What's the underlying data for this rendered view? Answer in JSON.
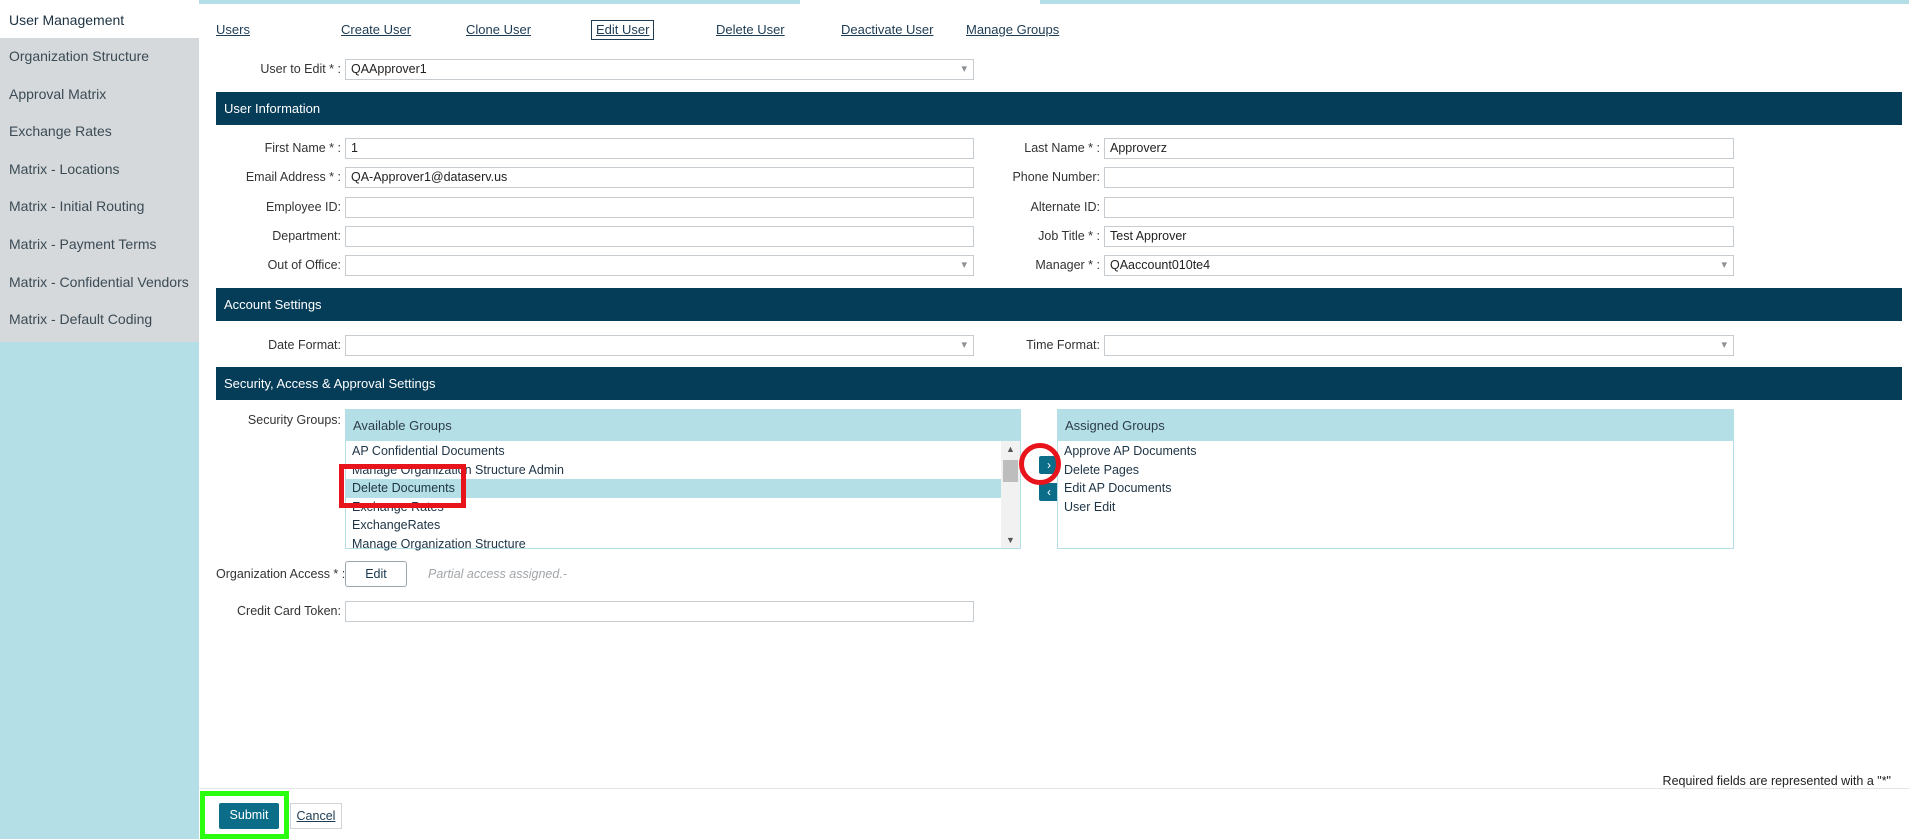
{
  "sidebar": {
    "items": [
      {
        "label": "User Management"
      },
      {
        "label": "Organization Structure"
      },
      {
        "label": "Approval Matrix"
      },
      {
        "label": "Exchange Rates"
      },
      {
        "label": "Matrix - Locations"
      },
      {
        "label": "Matrix - Initial Routing"
      },
      {
        "label": "Matrix - Payment Terms"
      },
      {
        "label": "Matrix - Confidential Vendors"
      },
      {
        "label": "Matrix - Default Coding"
      }
    ]
  },
  "tabs": {
    "users": "Users",
    "create": "Create User",
    "clone": "Clone User",
    "edit": "Edit User",
    "delete": "Delete User",
    "deactivate": "Deactivate User",
    "groups": "Manage Groups"
  },
  "user_to_edit": {
    "label": "User to Edit * :",
    "value": "QAApprover1"
  },
  "sections": {
    "user_info": "User Information",
    "account": "Account Settings",
    "security": "Security, Access & Approval Settings"
  },
  "user_info": {
    "first_name": {
      "label": "First Name * :",
      "value": "1"
    },
    "email": {
      "label": "Email Address * :",
      "value": "QA-Approver1@dataserv.us"
    },
    "employee_id": {
      "label": "Employee ID:",
      "value": ""
    },
    "department": {
      "label": "Department:",
      "value": ""
    },
    "out_of_office": {
      "label": "Out of Office:",
      "value": ""
    },
    "last_name": {
      "label": "Last Name * :",
      "value": "Approverz"
    },
    "phone": {
      "label": "Phone Number:",
      "value": ""
    },
    "alternate_id": {
      "label": "Alternate ID:",
      "value": ""
    },
    "job_title": {
      "label": "Job Title * :",
      "value": "Test Approver"
    },
    "manager": {
      "label": "Manager * :",
      "value": "QAaccount010te4"
    }
  },
  "account": {
    "date_format": {
      "label": "Date Format:",
      "value": ""
    },
    "time_format": {
      "label": "Time Format:",
      "value": ""
    }
  },
  "security": {
    "label": "Security Groups:",
    "available_title": "Available Groups",
    "available": [
      "AP Confidential Documents",
      "Manage Organization Structure Admin",
      "Delete Documents",
      "Exchange Rates",
      "ExchangeRates",
      "Manage Organization Structure"
    ],
    "assigned_title": "Assigned Groups",
    "assigned": [
      "Approve AP Documents",
      "Delete Pages",
      "Edit AP Documents",
      "User Edit"
    ],
    "move_right": "›",
    "move_left": "‹"
  },
  "org_access": {
    "label": "Organization Access * :",
    "button": "Edit",
    "note": "Partial access assigned.-"
  },
  "cc_token": {
    "label": "Credit Card Token:",
    "value": ""
  },
  "actions": {
    "submit": "Submit",
    "cancel": "Cancel"
  },
  "footnote": "Required fields are represented with a \"*\""
}
